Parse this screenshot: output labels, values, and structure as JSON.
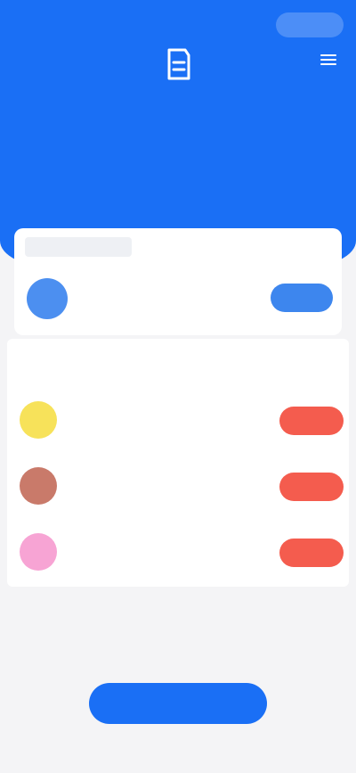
{
  "colors": {
    "header": "#1a6ff5",
    "primary_button": "#3d86ee",
    "accent_button": "#f45c4e",
    "background": "#f4f4f6"
  },
  "nav": {
    "left_label": "",
    "back_icon": "arrow-left-icon",
    "more_icon": "menu-icon"
  },
  "hero": {
    "icon": "app-icon",
    "title": "",
    "left_label": "",
    "right_label": ""
  },
  "featured": {
    "tag": "",
    "app": {
      "name": "",
      "desc": "",
      "button": ""
    }
  },
  "list": {
    "title": "",
    "more": "",
    "items": [
      {
        "name": "",
        "desc": "",
        "button": "",
        "icon_color": "#f7e25a"
      },
      {
        "name": "",
        "desc": "",
        "button": "",
        "icon_color": "#c97a6a"
      },
      {
        "name": "",
        "desc": "",
        "button": "",
        "icon_color": "#f7a4d4"
      }
    ]
  },
  "bottom": {
    "button": "",
    "footer": ""
  }
}
